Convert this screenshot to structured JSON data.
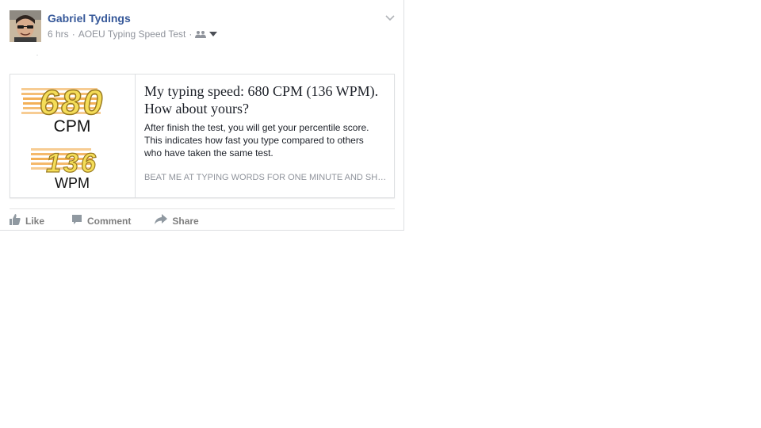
{
  "post": {
    "author": "Gabriel Tydings",
    "meta": {
      "time": "6 hrs",
      "separator": "·",
      "app": "AOEU Typing Speed Test",
      "audience_icon": "friends-icon"
    }
  },
  "card": {
    "image": {
      "cpm_number": "680",
      "cpm_unit": "CPM",
      "wpm_number": "136",
      "wpm_unit": "WPM"
    },
    "title": "My typing speed: 680 CPM (136 WPM). How about yours?",
    "description": "After finish the test, you will get your percentile score. This indicates how fast you type compared to others who have taken the same test.",
    "domain": "BEAT ME AT TYPING WORDS FOR ONE MINUTE AND SHARE YOUR SCORE"
  },
  "actions": {
    "like": "Like",
    "comment": "Comment",
    "share": "Share"
  },
  "colors": {
    "author": "#365899",
    "meta": "#90949c",
    "number_fill": "#f5dd58",
    "number_stroke": "#9a7c21",
    "stripes": "#f1a23a"
  }
}
